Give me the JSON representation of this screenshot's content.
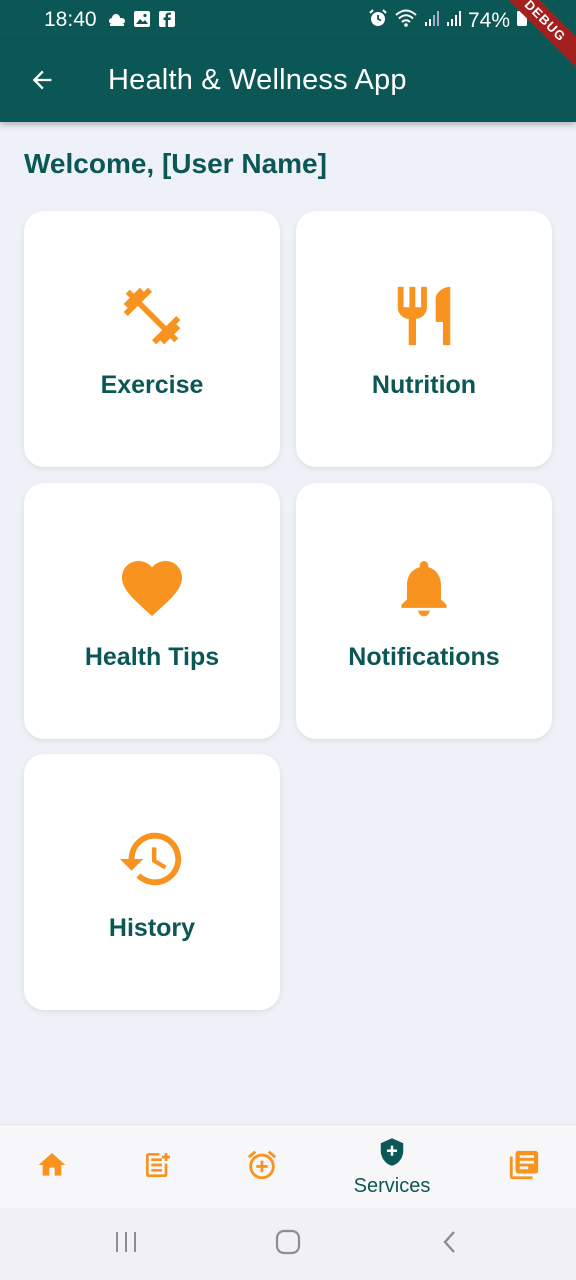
{
  "status_bar": {
    "time": "18:40",
    "battery": "74%",
    "left_icons": [
      "weather-icon",
      "gallery-icon",
      "facebook-icon"
    ],
    "right_icons": [
      "alarm-icon",
      "wifi-icon",
      "signal-icon",
      "signal-icon",
      "battery-icon"
    ]
  },
  "debug_banner": "DEBUG",
  "app_bar": {
    "title": "Health & Wellness App",
    "back_icon": "arrow-back-icon"
  },
  "welcome": "Welcome, [User Name]",
  "cards": [
    {
      "label": "Exercise",
      "icon": "dumbbell-icon"
    },
    {
      "label": "Nutrition",
      "icon": "fork-knife-icon"
    },
    {
      "label": "Health Tips",
      "icon": "heart-icon"
    },
    {
      "label": "Notifications",
      "icon": "bell-icon"
    },
    {
      "label": "History",
      "icon": "history-icon"
    }
  ],
  "bottom_nav": {
    "items": [
      {
        "icon": "home-icon",
        "label": ""
      },
      {
        "icon": "note-add-icon",
        "label": ""
      },
      {
        "icon": "add-alarm-icon",
        "label": ""
      },
      {
        "icon": "shield-plus-icon",
        "label": "Services",
        "selected": true
      },
      {
        "icon": "library-books-icon",
        "label": ""
      }
    ]
  },
  "system_nav": [
    "recents-icon",
    "home-circle-icon",
    "back-chevron-icon"
  ],
  "colors": {
    "primary": "#0B5755",
    "accent": "#F7931E",
    "background": "#EEF1F7",
    "card": "#FFFFFF"
  }
}
